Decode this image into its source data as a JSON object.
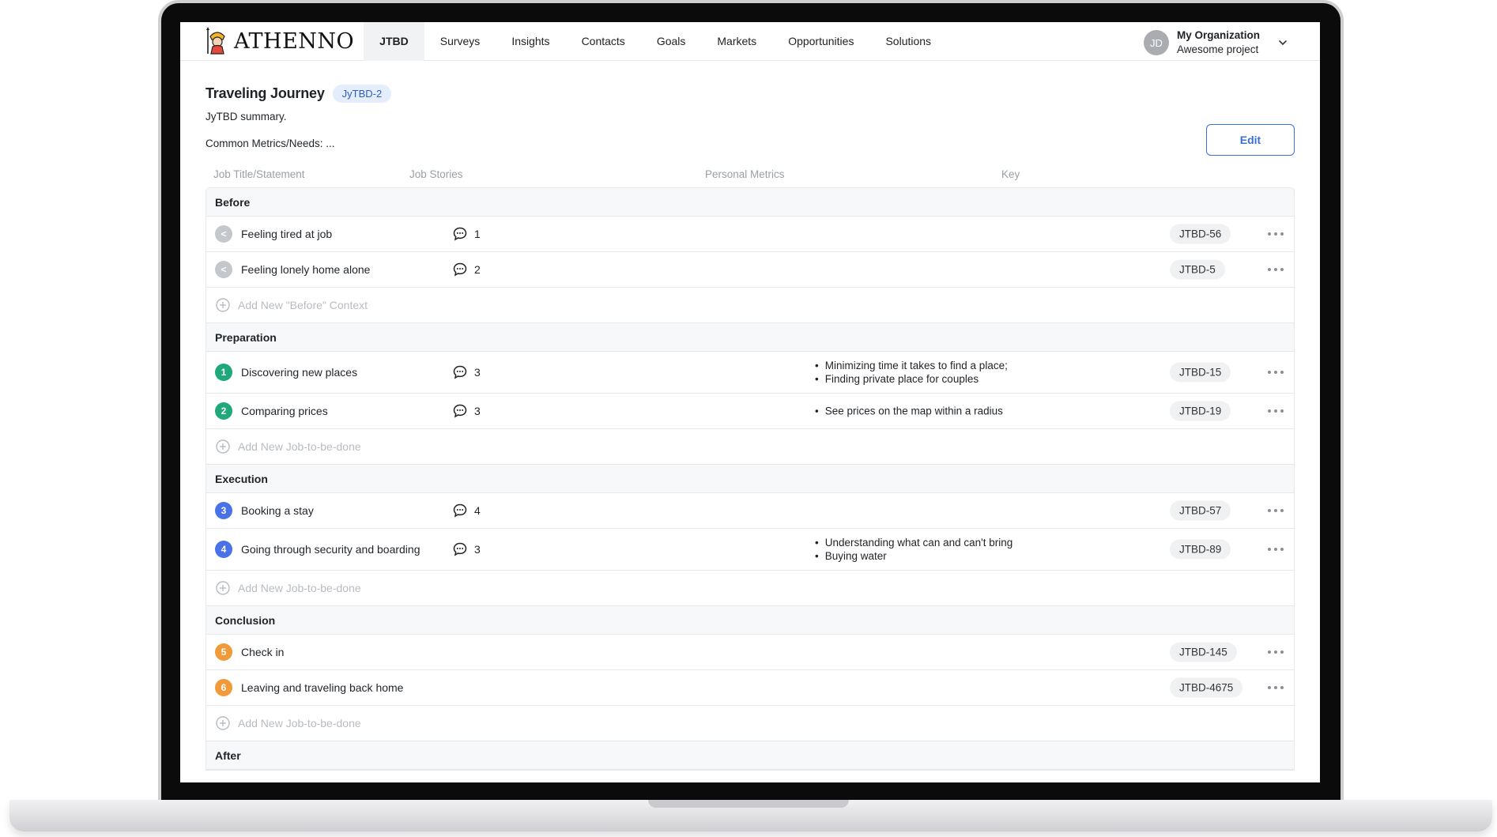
{
  "app": {
    "logo_text": "ATHENNO"
  },
  "nav": {
    "items": [
      {
        "label": "JTBD",
        "active": true
      },
      {
        "label": "Surveys"
      },
      {
        "label": "Insights"
      },
      {
        "label": "Contacts"
      },
      {
        "label": "Goals"
      },
      {
        "label": "Markets"
      },
      {
        "label": "Opportunities"
      },
      {
        "label": "Solutions"
      }
    ]
  },
  "org": {
    "initials": "JD",
    "name": "My Organization",
    "project": "Awesome project"
  },
  "page": {
    "title": "Traveling Journey",
    "key": "JyTBD-2",
    "summary": "JyTBD summary.",
    "metrics": "Common Metrics/Needs: ...",
    "edit_label": "Edit"
  },
  "columns": {
    "title": "Job Title/Statement",
    "stories": "Job Stories",
    "metrics": "Personal Metrics",
    "key": "Key"
  },
  "groups": [
    {
      "name": "Before",
      "rows": [
        {
          "marker": "<",
          "color": "#c4c7cc",
          "title": "Feeling tired at job",
          "stories": "1",
          "metrics": [],
          "key": "JTBD-56"
        },
        {
          "marker": "<",
          "color": "#c4c7cc",
          "title": "Feeling lonely home alone",
          "stories": "2",
          "metrics": [],
          "key": "JTBD-5"
        }
      ],
      "add_label": "Add New \"Before\" Context"
    },
    {
      "name": "Preparation",
      "rows": [
        {
          "marker": "1",
          "color": "#1fa87a",
          "title": "Discovering new places",
          "stories": "3",
          "metrics": [
            "Minimizing time it takes to find a place;",
            "Finding private place for couples"
          ],
          "key": "JTBD-15"
        },
        {
          "marker": "2",
          "color": "#1fa87a",
          "title": "Comparing prices",
          "stories": "3",
          "metrics": [
            "See prices on the map within a radius"
          ],
          "key": "JTBD-19"
        }
      ],
      "add_label": "Add New Job-to-be-done"
    },
    {
      "name": "Execution",
      "rows": [
        {
          "marker": "3",
          "color": "#4a72e8",
          "title": "Booking a stay",
          "stories": "4",
          "metrics": [],
          "key": "JTBD-57"
        },
        {
          "marker": "4",
          "color": "#4a72e8",
          "title": "Going through security and boarding",
          "stories": "3",
          "metrics": [
            "Understanding what can and can't bring",
            "Buying water"
          ],
          "key": "JTBD-89"
        }
      ],
      "add_label": "Add New Job-to-be-done"
    },
    {
      "name": "Conclusion",
      "rows": [
        {
          "marker": "5",
          "color": "#f29a3a",
          "title": "Check in",
          "stories": "",
          "metrics": [],
          "key": "JTBD-145"
        },
        {
          "marker": "6",
          "color": "#f29a3a",
          "title": "Leaving and traveling back home",
          "stories": "",
          "metrics": [],
          "key": "JTBD-4675"
        }
      ],
      "add_label": "Add New Job-to-be-done"
    },
    {
      "name": "After",
      "rows": [],
      "add_label": ""
    }
  ]
}
